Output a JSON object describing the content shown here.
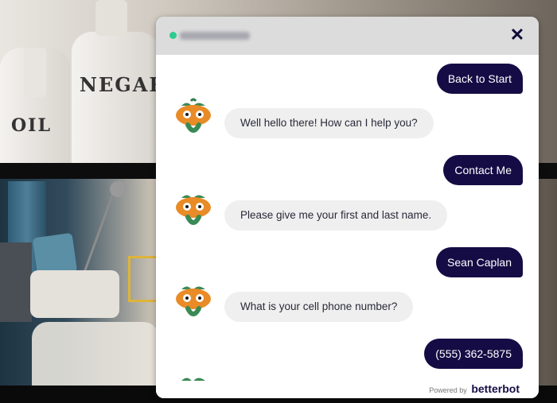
{
  "background": {
    "bottle_labels": [
      "OIL",
      "NEGAR"
    ]
  },
  "chat": {
    "close_symbol": "✕",
    "status_color": "#2ecc8f",
    "user_bubble_color": "#150c45",
    "messages": [
      {
        "from": "user",
        "text": "Back to Start"
      },
      {
        "from": "bot",
        "text": "Well hello there! How can I help you?"
      },
      {
        "from": "user",
        "text": "Contact Me"
      },
      {
        "from": "bot",
        "text": "Please give me your first and last name."
      },
      {
        "from": "user",
        "text": "Sean Caplan"
      },
      {
        "from": "bot",
        "text": "What is your cell phone number?"
      },
      {
        "from": "user",
        "text": "(555) 362-5875"
      }
    ],
    "footer": {
      "powered_by": "Powered by",
      "brand_part1": "better",
      "brand_part2": "bot"
    },
    "avatar_icon": "pumpkin-face-icon"
  }
}
